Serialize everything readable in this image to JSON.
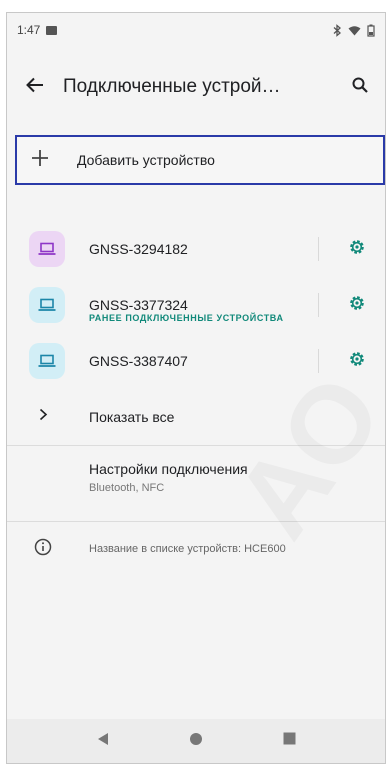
{
  "status": {
    "time": "1:47"
  },
  "appbar": {
    "title": "Подключенные устрой…"
  },
  "add_device": {
    "label": "Добавить устройство"
  },
  "section_header": "РАНЕЕ ПОДКЛЮЧЕННЫЕ УСТРОЙСТВА",
  "devices": [
    {
      "name": "GNSS-3294182",
      "icon_bg": "#ecd6f4",
      "icon_color": "#8e35c7"
    },
    {
      "name": "GNSS-3377324",
      "icon_bg": "#d2eef6",
      "icon_color": "#1b86a8"
    },
    {
      "name": "GNSS-3387407",
      "icon_bg": "#d2eef6",
      "icon_color": "#1b86a8"
    }
  ],
  "show_all": {
    "label": "Показать все"
  },
  "connection_settings": {
    "title": "Настройки подключения",
    "subtitle": "Bluetooth, NFC"
  },
  "device_name_info": "Название в списке устройств: HCE600",
  "colors": {
    "accent": "#11897a",
    "focus_border": "#2a3aa8"
  }
}
